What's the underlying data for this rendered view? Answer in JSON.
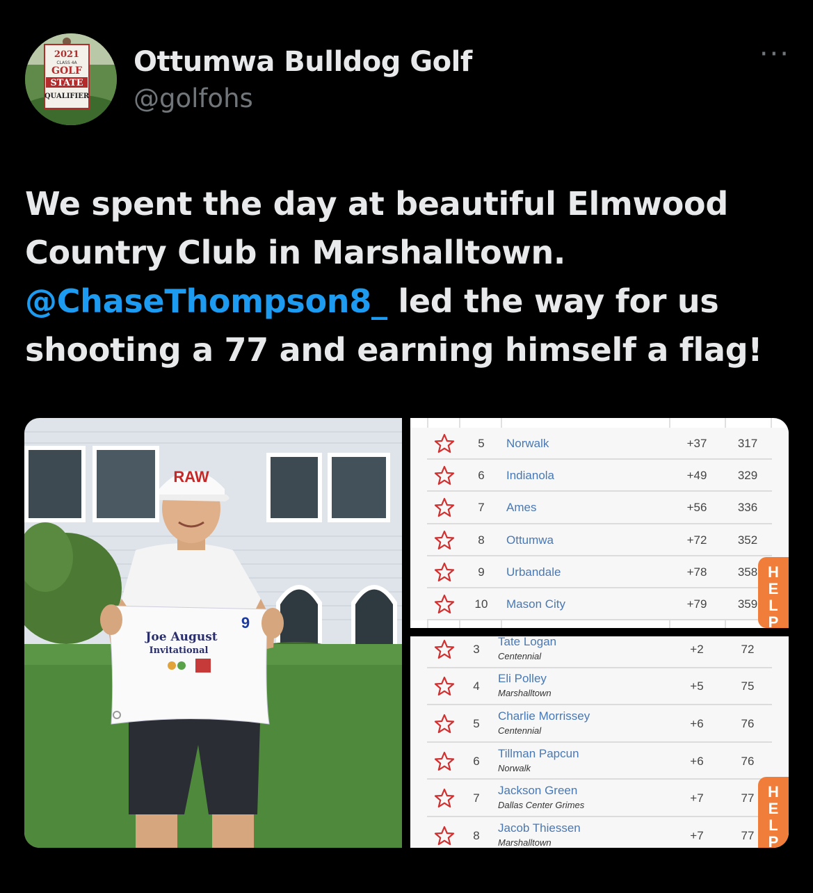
{
  "author": {
    "display_name": "Ottumwa Bulldog Golf",
    "handle": "@golfohs",
    "avatar_banner": [
      "2021",
      "CLASS 4A",
      "GOLF",
      "STATE",
      "QUALIFIER"
    ]
  },
  "more_icon": "···",
  "tweet": {
    "line1": "We spent the day at beautiful Elmwood",
    "line2": "Country Club in Marshalltown.",
    "mention": "@ChaseThompson8_",
    "line3_rest": " led the way for us",
    "line4": "shooting a 77 and earning himself a flag!"
  },
  "photo": {
    "cap_text": "RAW",
    "flag_number": "9",
    "flag_line1": "Joe August",
    "flag_line2": "Invitational"
  },
  "team_standings": [
    {
      "pos": "5",
      "team": "Norwalk",
      "par": "+37",
      "total": "317"
    },
    {
      "pos": "6",
      "team": "Indianola",
      "par": "+49",
      "total": "329"
    },
    {
      "pos": "7",
      "team": "Ames",
      "par": "+56",
      "total": "336"
    },
    {
      "pos": "8",
      "team": "Ottumwa",
      "par": "+72",
      "total": "352"
    },
    {
      "pos": "9",
      "team": "Urbandale",
      "par": "+78",
      "total": "358"
    },
    {
      "pos": "10",
      "team": "Mason City",
      "par": "+79",
      "total": "359"
    }
  ],
  "individual_standings": [
    {
      "pos": "3",
      "name": "Tate Logan",
      "school": "Centennial",
      "par": "+2",
      "total": "72"
    },
    {
      "pos": "4",
      "name": "Eli Polley",
      "school": "Marshalltown",
      "par": "+5",
      "total": "75"
    },
    {
      "pos": "5",
      "name": "Charlie Morrissey",
      "school": "Centennial",
      "par": "+6",
      "total": "76"
    },
    {
      "pos": "6",
      "name": "Tillman Papcun",
      "school": "Norwalk",
      "par": "+6",
      "total": "76"
    },
    {
      "pos": "7",
      "name": "Jackson Green",
      "school": "Dallas Center Grimes",
      "par": "+7",
      "total": "77"
    },
    {
      "pos": "8",
      "name": "Jacob Thiessen",
      "school": "Marshalltown",
      "par": "+7",
      "total": "77"
    }
  ],
  "help_label": "HELP",
  "colors": {
    "background": "#000000",
    "text": "#e7e9ea",
    "secondary": "#71767b",
    "mention": "#1d9bf0",
    "link_blue": "#4878b4",
    "help_orange": "#f07e3a",
    "star_red": "#d03030"
  }
}
